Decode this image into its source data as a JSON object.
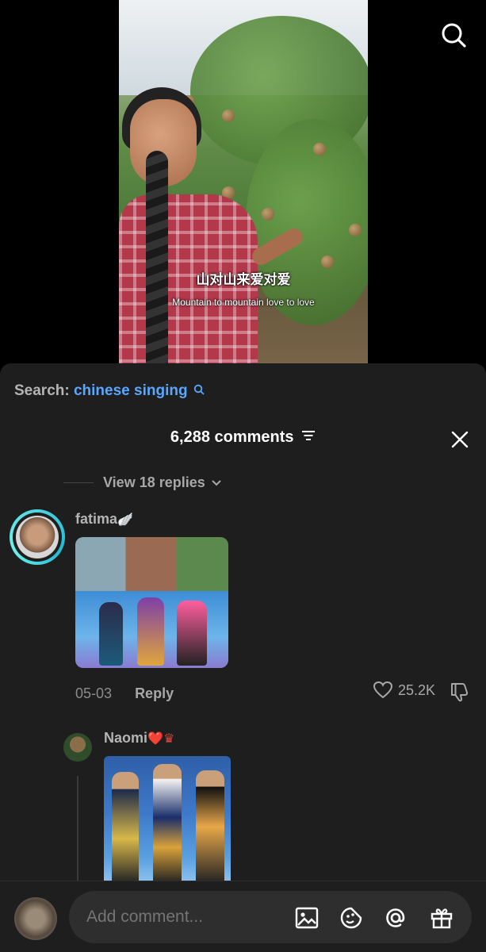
{
  "video": {
    "caption_zh": "山对山来爱对爱",
    "caption_en": "Mountain to mountain love to love"
  },
  "icons": {
    "search": "search-icon",
    "close": "close-icon",
    "filter": "sort-filter-icon",
    "heart": "heart-icon",
    "dislike": "thumbs-down-icon",
    "image": "image-icon",
    "sticker": "sticker-icon",
    "mention": "at-sign-icon",
    "gift": "gift-icon"
  },
  "colors": {
    "sheet_bg": "#1e1e1e",
    "link_blue": "#5aa7ff",
    "ring_cyan": "#4fd6e0",
    "muted_text": "#a8a8a8"
  },
  "comments_panel": {
    "search_label": "Search:",
    "search_term": "chinese singing",
    "count_label": "6,288 comments",
    "view_replies": "View 18 replies",
    "comments": [
      {
        "username": "fatima",
        "badge": "🪽",
        "date": "05-03",
        "reply_label": "Reply",
        "likes": "25.2K"
      }
    ],
    "replies": [
      {
        "username": "Naomi",
        "badge": "❤️♛"
      }
    ]
  },
  "composer": {
    "placeholder": "Add comment..."
  }
}
